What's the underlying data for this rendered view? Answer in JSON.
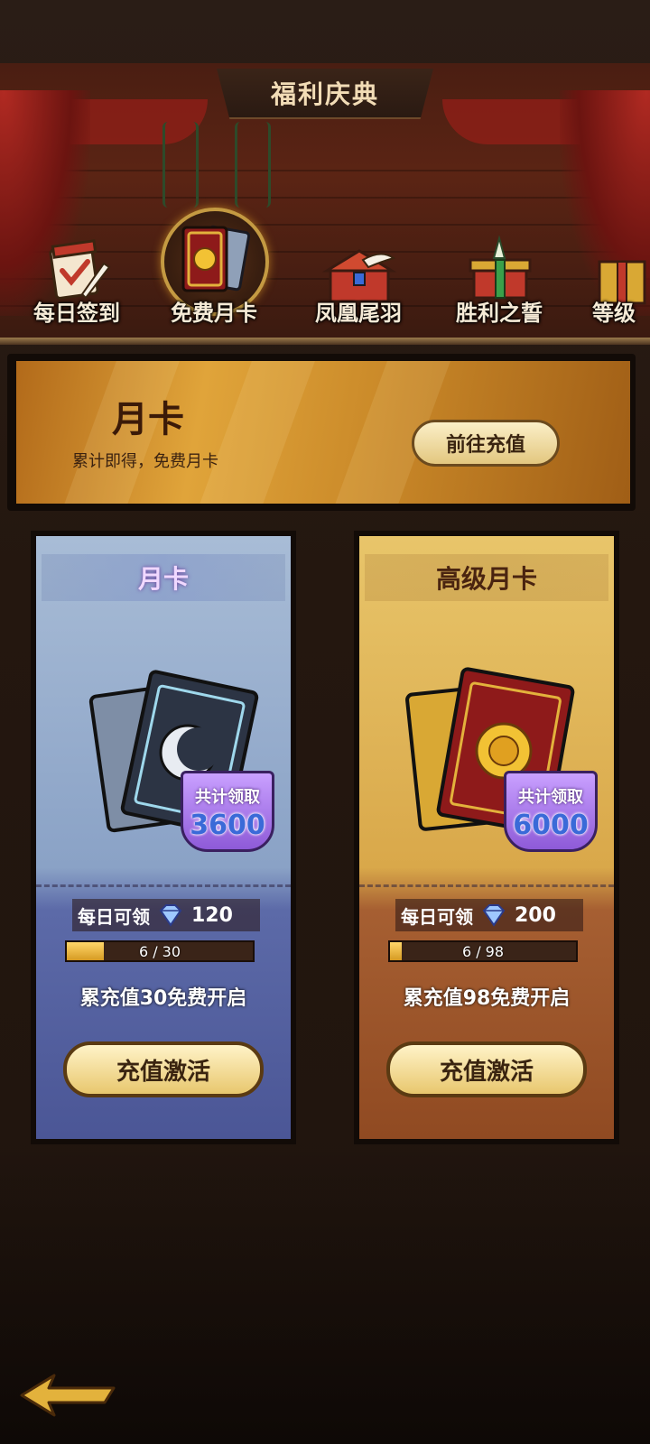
{
  "header": {
    "title": "福利庆典"
  },
  "tabs": [
    {
      "label": "每日签到",
      "icon": "calendar-quill-icon",
      "active": false
    },
    {
      "label": "免费月卡",
      "icon": "gold-card-icon",
      "active": true
    },
    {
      "label": "凤凰尾羽",
      "icon": "feather-chest-icon",
      "active": false
    },
    {
      "label": "胜利之誓",
      "icon": "gift-sword-icon",
      "active": false
    },
    {
      "label": "等级",
      "icon": "gift-box-icon",
      "active": false
    }
  ],
  "banner": {
    "title": "月卡",
    "subtitle": "累计即得，免费月卡",
    "button_label": "前往充值"
  },
  "cards": [
    {
      "name": "月卡",
      "badge_line1": "共计领取",
      "badge_value": "3600",
      "daily_label": "每日可领",
      "daily_value": "120",
      "progress_text": "6 / 30",
      "progress_fraction": 0.2,
      "requirement": "累充值30免费开启",
      "button_label": "充值激活",
      "theme": "#8aa2c6"
    },
    {
      "name": "高级月卡",
      "badge_line1": "共计领取",
      "badge_value": "6000",
      "daily_label": "每日可领",
      "daily_value": "200",
      "progress_text": "6 / 98",
      "progress_fraction": 0.0612,
      "requirement": "累充值98免费开启",
      "button_label": "充值激活",
      "theme": "#e8c56a"
    }
  ],
  "footer": {
    "back_icon": "back-arrow-icon"
  }
}
